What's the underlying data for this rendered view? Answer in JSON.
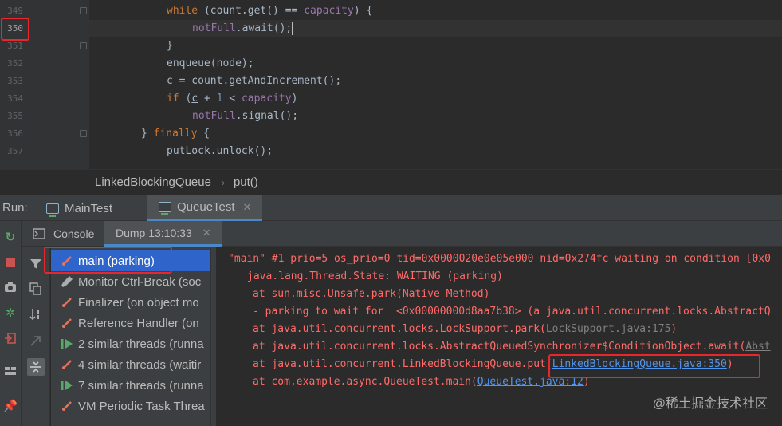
{
  "editor": {
    "line_numbers": [
      "349",
      "350",
      "351",
      "352",
      "353",
      "354",
      "355",
      "356",
      "357"
    ],
    "code": {
      "l349": {
        "kw": "while",
        "a": " (count.get() == ",
        "fld": "capacity",
        "b": ") {"
      },
      "l350": {
        "fld": "notFull",
        "a": ".await();"
      },
      "l351": {
        "a": "}"
      },
      "l352": {
        "a": "enqueue(node);"
      },
      "l353": {
        "v": "c",
        "a": " = count.getAndIncrement();"
      },
      "l354": {
        "kw": "if",
        "a": " (",
        "v": "c",
        "b": " + ",
        "num": "1",
        "c": " < ",
        "fld": "capacity",
        "d": ")"
      },
      "l355": {
        "fld": "notFull",
        "a": ".signal();"
      },
      "l356": {
        "a": "} ",
        "kw": "finally",
        "b": " {"
      },
      "l357": {
        "a": "putLock.unlock();"
      }
    }
  },
  "breadcrumb": {
    "class_name": "LinkedBlockingQueue",
    "separator": "›",
    "method": "put()"
  },
  "run": {
    "label": "Run:",
    "tabs": [
      {
        "label": "MainTest"
      },
      {
        "label": "QueueTest"
      }
    ],
    "close_glyph": "✕"
  },
  "subtabs": {
    "console": "Console",
    "dump": "Dump 13:10:33",
    "close_glyph": "✕"
  },
  "threads": [
    {
      "label": "main (parking)",
      "icon": "parked-thread-icon"
    },
    {
      "label": "Monitor Ctrl-Break (soc",
      "icon": "running-thread-icon"
    },
    {
      "label": "Finalizer (on object mo",
      "icon": "parked-thread-icon"
    },
    {
      "label": "Reference Handler (on",
      "icon": "parked-thread-icon"
    },
    {
      "label": "2 similar threads (runna",
      "icon": "similar-threads-running-icon"
    },
    {
      "label": "4 similar threads (waitir",
      "icon": "parked-thread-icon"
    },
    {
      "label": "7 similar threads (runna",
      "icon": "similar-threads-running-icon"
    },
    {
      "label": "VM Periodic Task Threa",
      "icon": "parked-thread-icon"
    }
  ],
  "console": {
    "l1": "\"main\" #1 prio=5 os_prio=0 tid=0x0000020e0e05e000 nid=0x274fc waiting on condition [0x0",
    "l2": "java.lang.Thread.State: WAITING (parking)",
    "l3": "at sun.misc.Unsafe.park(Native Method)",
    "l4": "- parking to wait for  <0x00000000d8aa7b38> (a java.util.concurrent.locks.AbstractQ",
    "l5a": "at java.util.concurrent.locks.LockSupport.park(",
    "l5link": "LockSupport.java:175",
    "l5b": ")",
    "l6a": "at java.util.concurrent.locks.AbstractQueuedSynchronizer$ConditionObject.await(",
    "l6link": "Abst",
    "l7a": "at java.util.concurrent.LinkedBlockingQueue.put(",
    "l7link": "LinkedBlockingQueue.java:350",
    "l7b": ")",
    "l8a": "at com.example.async.QueueTest.main(",
    "l8link": "QueueTest.java:12",
    "l8b": ")"
  },
  "watermark": "@稀土掘金技术社区",
  "colors": {
    "highlight": "#e8262b",
    "accent": "#4a88c7",
    "error_text": "#ff6b68",
    "link": "#5394ec"
  }
}
